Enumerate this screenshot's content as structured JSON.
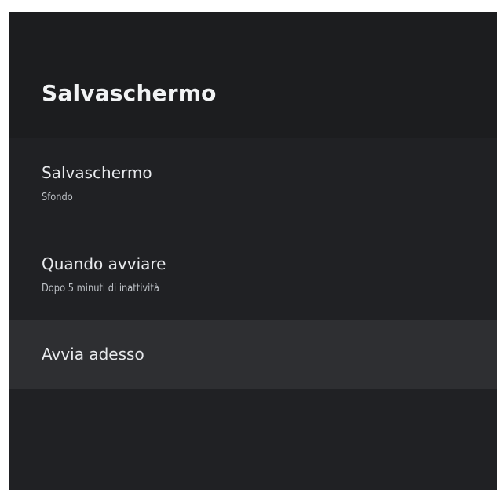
{
  "header": {
    "title": "Salvaschermo"
  },
  "settings": {
    "items": [
      {
        "title": "Salvaschermo",
        "subtitle": "Sfondo"
      },
      {
        "title": "Quando avviare",
        "subtitle": "Dopo 5 minuti di inattività"
      },
      {
        "title": "Avvia adesso",
        "focused": true
      }
    ]
  },
  "colors": {
    "background": "#202124",
    "header_background": "#1c1d1f",
    "focused_item_background": "#2e2f32",
    "title_text": "#f1f3f4",
    "secondary_text": "#bdc1c6"
  }
}
